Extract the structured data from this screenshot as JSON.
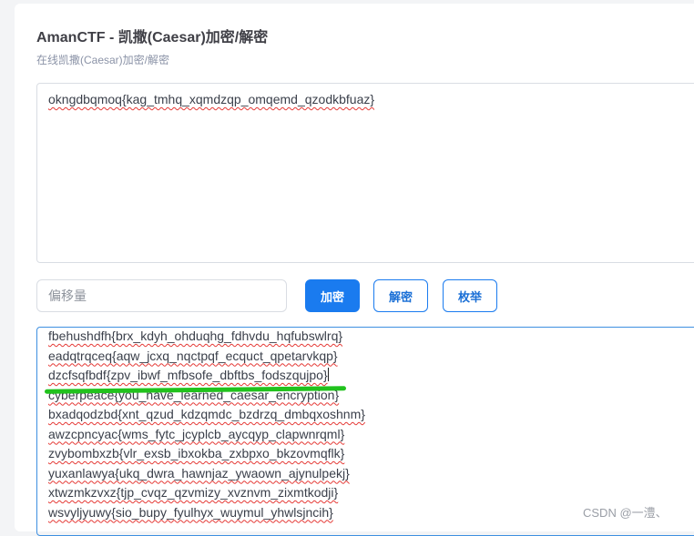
{
  "page": {
    "title": "AmanCTF - 凯撒(Caesar)加密/解密",
    "subtitle": "在线凯撒(Caesar)加密/解密"
  },
  "input_text": "okngdbqmoq{kag_tmhq_xqmdzqp_omqemd_qzodkbfuaz}",
  "offset": {
    "value": "",
    "placeholder": "偏移量"
  },
  "buttons": {
    "encrypt": "加密",
    "decrypt": "解密",
    "enumerate": "枚举"
  },
  "output_lines": [
    "fbehushdfh{brx_kdyh_ohduqhg_fdhvdu_hqfubswlrq}",
    "eadqtrqceq{aqw_jcxq_nqctpqf_ecquct_qpetarvkqp}",
    "dzcfsqfbdf{zpv_ibwf_mfbsofe_dbftbs_fodszqujpo}",
    "cyberpeace{you_have_learned_caesar_encryption}",
    "bxadqodzbd{xnt_qzud_kdzqmdc_bzdrzq_dmbqxoshnm}",
    "awzcpncyac{wms_fytc_jcyplcb_aycqyp_clapwnrqml}",
    "zvybombxzb{vlr_exsb_ibxokba_zxbpxo_bkzovmqflk}",
    "yuxanlawya{ukq_dwra_hawnjaz_ywaown_ajynulpekj}",
    "xtwzmkzvxz{tjp_cvqz_qzvmizy_xvznvm_zixmtkodji}",
    "wsvyljyuwy{sio_bupy_fyulhyx_wuymul_yhwlsjncih}"
  ],
  "watermark": "CSDN @一澧、",
  "colors": {
    "accent": "#1a7bef",
    "highlight": "#21c21d"
  }
}
